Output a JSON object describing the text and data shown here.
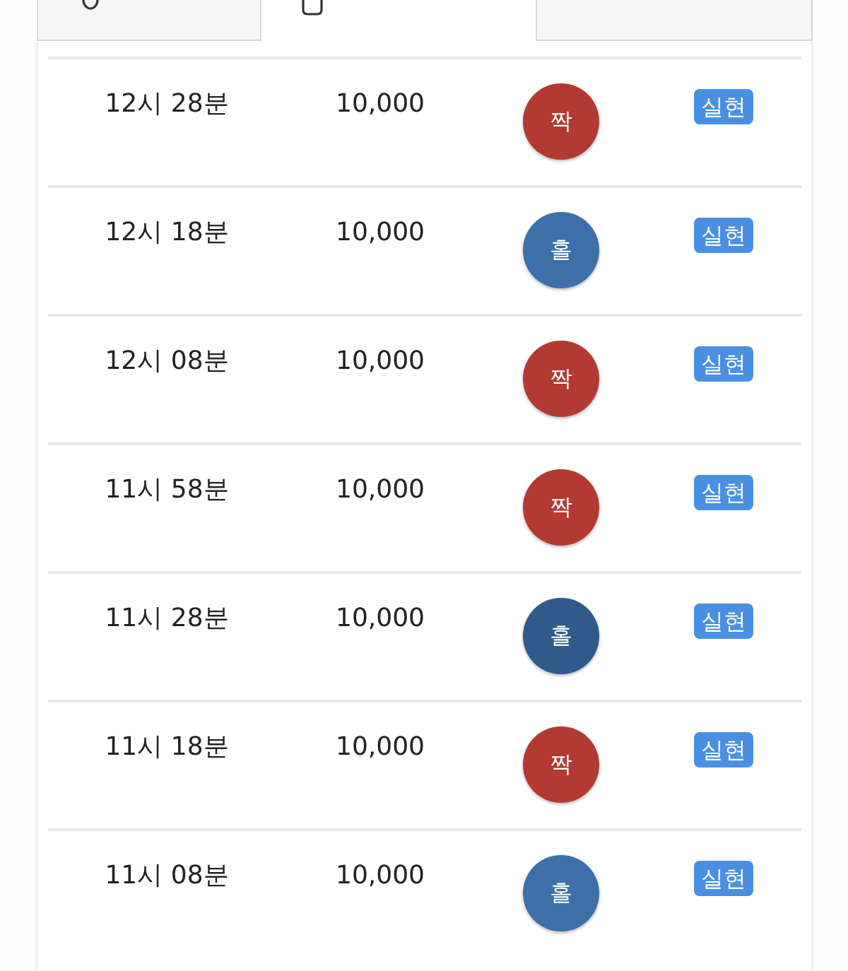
{
  "tabs": [
    {
      "selected": false
    },
    {
      "selected": true
    },
    {
      "selected": false
    }
  ],
  "rows": [
    {
      "time": "12시 28분",
      "amount": "10,000",
      "result": {
        "label": "짝",
        "color": "#b23a33"
      },
      "tag": "실현"
    },
    {
      "time": "12시 18분",
      "amount": "10,000",
      "result": {
        "label": "홀",
        "color": "#3e6fa8"
      },
      "tag": "실현"
    },
    {
      "time": "12시 08분",
      "amount": "10,000",
      "result": {
        "label": "짝",
        "color": "#b23a33"
      },
      "tag": "실현"
    },
    {
      "time": "11시 58분",
      "amount": "10,000",
      "result": {
        "label": "짝",
        "color": "#b23a33"
      },
      "tag": "실현"
    },
    {
      "time": "11시 28분",
      "amount": "10,000",
      "result": {
        "label": "홀",
        "color": "#305a8a"
      },
      "tag": "실현"
    },
    {
      "time": "11시 18분",
      "amount": "10,000",
      "result": {
        "label": "짝",
        "color": "#b23a33"
      },
      "tag": "실현"
    },
    {
      "time": "11시 08분",
      "amount": "10,000",
      "result": {
        "label": "홀",
        "color": "#3e6fa8"
      },
      "tag": "실현"
    }
  ]
}
